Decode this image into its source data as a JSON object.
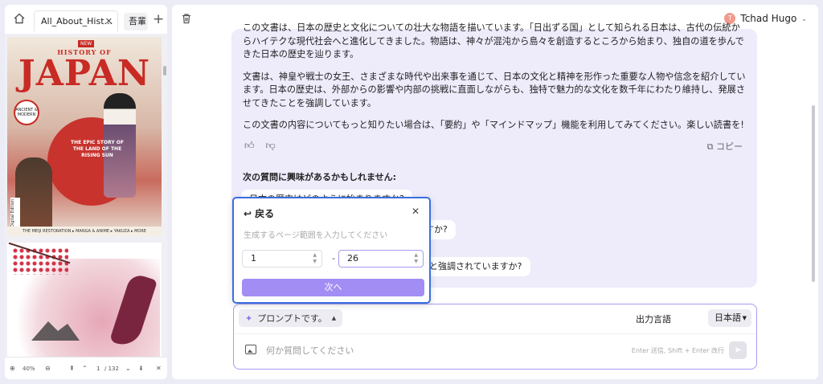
{
  "left_panel": {
    "tab_active": "All_About_Hist…",
    "tab_second": "吾輩",
    "cover": {
      "badge": "NEW",
      "subtitle": "HISTORY OF",
      "title": "JAPAN",
      "circle_text": "ANCIENT & MODERN",
      "epic": "THE EPIC STORY OF THE LAND OF THE RISING SUN",
      "digital": "Digital Edition",
      "footer": "THE MEIJI RESTORATION ▸ MANGA & ANIME ▸ YAKUZA ▸ MORE"
    },
    "bottom_bar": {
      "zoom": "40%",
      "page": "1",
      "total": "/ 132"
    }
  },
  "header": {
    "user_name": "Tchad Hugo",
    "user_initial": "T"
  },
  "chat": {
    "paragraphs": [
      "この文書は、日本の歴史と文化についての壮大な物語を描いています。「日出ずる国」として知られる日本は、古代の伝統からハイテクな現代社会へと進化してきました。物語は、神々が混沌から島々を創造するところから始まり、独自の道を歩んできた日本の歴史を辿ります。",
      "文書は、神皇や戦士の女王、さまざまな時代や出来事を通じて、日本の文化と精神を形作った重要な人物や信念を紹介しています。日本の歴史は、外部からの影響や内部の挑戦に直面しながらも、独特で魅力的な文化を数千年にわたり維持し、発展させてきたことを強調しています。",
      "この文書の内容についてもっと知りたい場合は、「要約」や「マインドマップ」機能を利用してみてください。楽しい読書を!"
    ],
    "copy_label": "コピー",
    "suggest_heading": "次の質問に興味があるかもしれません:",
    "suggestions": [
      "日本の歴史はどのように始まりますか?",
      "ますか?",
      "と強調されていますか?"
    ]
  },
  "composer": {
    "prompt_label": "プロンプトです。",
    "lang_label": "出力言語",
    "lang_value": "日本語",
    "placeholder": "何か質問してください",
    "hint": "Enter 送信, Shift + Enter 改行"
  },
  "popup": {
    "back_label": "戻る",
    "hint": "生成するページ範囲を入力してください",
    "from": "1",
    "to": "26",
    "dash": "-",
    "next_label": "次へ"
  },
  "colors": {
    "accent": "#a28df4",
    "popup_border": "#3b6fe0",
    "bubble": "#eeebfb"
  }
}
